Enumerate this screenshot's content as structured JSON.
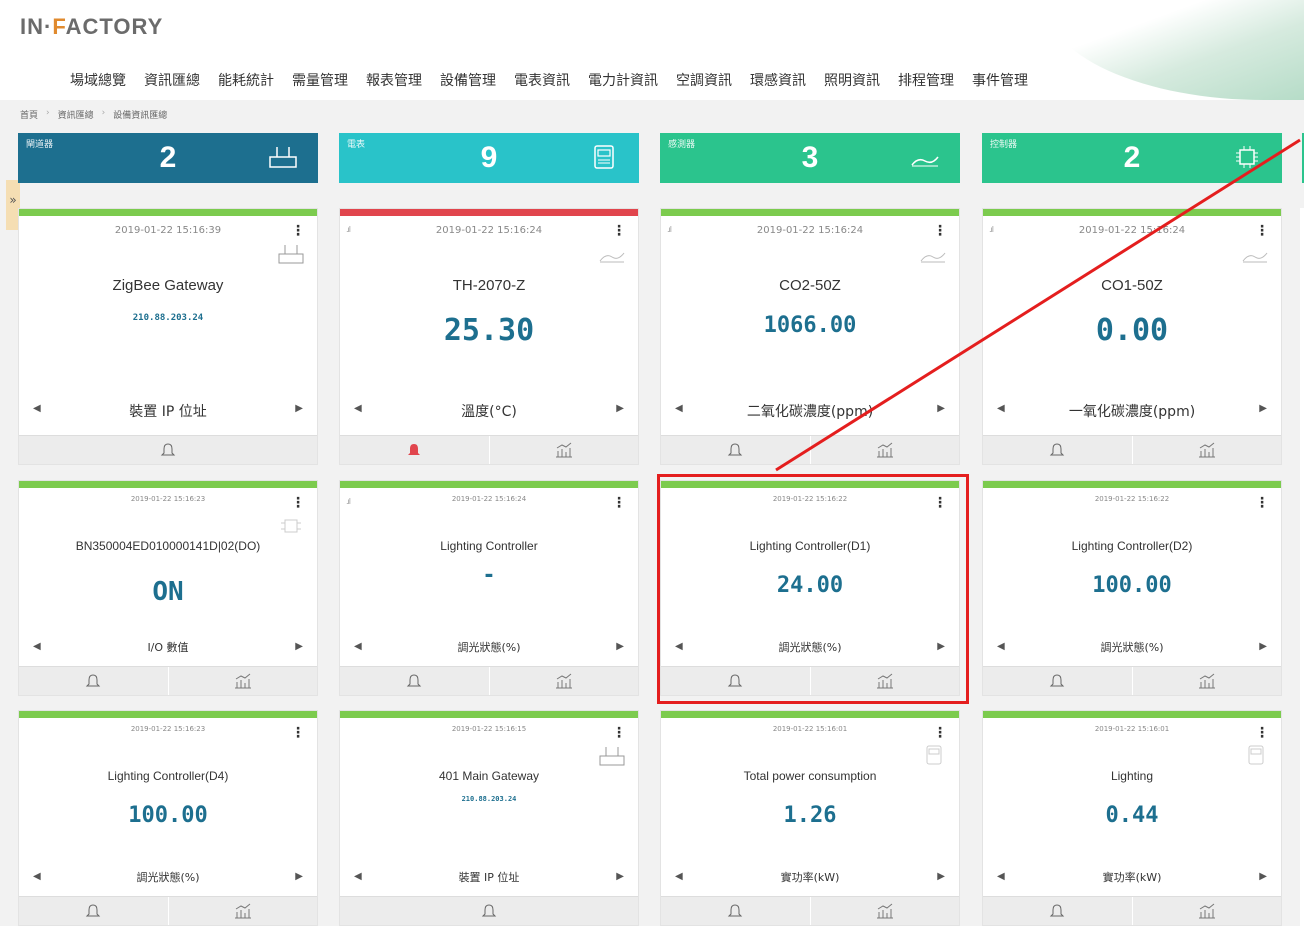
{
  "header": {
    "logo_part1": "IN·",
    "logo_f": "F",
    "logo_part2": "ACTORY",
    "nav": [
      "場域總覽",
      "資訊匯總",
      "能耗統計",
      "需量管理",
      "報表管理",
      "設備管理",
      "電表資訊",
      "電力計資訊",
      "空調資訊",
      "環感資訊",
      "照明資訊",
      "排程管理",
      "事件管理"
    ]
  },
  "breadcrumb": [
    "首頁",
    "資訊匯總",
    "設備資訊匯總"
  ],
  "sidebar_toggle": "»",
  "summary": [
    {
      "label": "閘道器",
      "count": "2",
      "color": "#1d6f8f",
      "icon": "gateway-icon"
    },
    {
      "label": "電表",
      "count": "9",
      "color": "#29c3c9",
      "icon": "meter-icon"
    },
    {
      "label": "感測器",
      "count": "3",
      "color": "#2bc48d",
      "icon": "sensor-icon"
    },
    {
      "label": "控制器",
      "count": "2",
      "color": "#2bc48d",
      "icon": "controller-icon"
    }
  ],
  "cards": [
    {
      "timestamp": "2019-01-22 15:16:39",
      "name": "ZigBee Gateway",
      "value": "210.88.203.24",
      "unit": "裝置 IP 位址",
      "alarm": false
    },
    {
      "timestamp": "2019-01-22 15:16:24",
      "name": "TH-2070-Z",
      "value": "25.30",
      "unit": "溫度(°C)",
      "alarm": true
    },
    {
      "timestamp": "2019-01-22 15:16:24",
      "name": "CO2-50Z",
      "value": "1066.00",
      "unit": "二氧化碳濃度(ppm)",
      "alarm": false
    },
    {
      "timestamp": "2019-01-22 15:16:24",
      "name": "CO1-50Z",
      "value": "0.00",
      "unit": "一氧化碳濃度(ppm)",
      "alarm": false
    },
    {
      "timestamp": "2019-01-22 15:16:23",
      "name": "BN350004ED010000141D|02(DO)",
      "value": "ON",
      "unit": "I/O 數值"
    },
    {
      "timestamp": "2019-01-22 15:16:24",
      "name": "Lighting Controller",
      "value": "-",
      "unit": "調光狀態(%)"
    },
    {
      "timestamp": "2019-01-22 15:16:22",
      "name": "Lighting Controller(D1)",
      "value": "24.00",
      "unit": "調光狀態(%)"
    },
    {
      "timestamp": "2019-01-22 15:16:22",
      "name": "Lighting Controller(D2)",
      "value": "100.00",
      "unit": "調光狀態(%)"
    },
    {
      "timestamp": "2019-01-22 15:16:23",
      "name": "Lighting Controller(D4)",
      "value": "100.00",
      "unit": "調光狀態(%)"
    },
    {
      "timestamp": "2019-01-22 15:16:15",
      "name": "401 Main Gateway",
      "value": "210.88.203.24",
      "unit": "裝置 IP 位址"
    },
    {
      "timestamp": "2019-01-22 15:16:01",
      "name": "Total power consumption",
      "value": "1.26",
      "unit": "實功率(kW)"
    },
    {
      "timestamp": "2019-01-22 15:16:01",
      "name": "Lighting",
      "value": "0.44",
      "unit": "實功率(kW)"
    }
  ],
  "colors": {
    "green_bar": "#7ccb4e",
    "red_bar": "#e1454d",
    "value_blue": "#1d6f8f",
    "highlight": "#e41e1e"
  }
}
